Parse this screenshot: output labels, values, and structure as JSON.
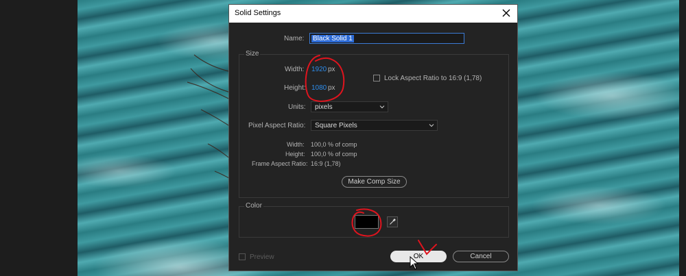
{
  "dialog": {
    "title": "Solid Settings",
    "name_label": "Name:",
    "name_value": "Black Solid 1",
    "size": {
      "group_title": "Size",
      "width_label": "Width:",
      "width_value": "1920",
      "width_unit": "px",
      "height_label": "Height:",
      "height_value": "1080",
      "height_unit": "px",
      "lock_label": "Lock Aspect Ratio to 16:9 (1,78)",
      "lock_checked": false,
      "units_label": "Units:",
      "units_value": "pixels",
      "par_label": "Pixel Aspect Ratio:",
      "par_value": "Square Pixels",
      "info_width_label": "Width:",
      "info_width_value": "100,0 % of comp",
      "info_height_label": "Height:",
      "info_height_value": "100,0 % of comp",
      "far_label": "Frame Aspect Ratio:",
      "far_value": "16:9 (1,78)",
      "make_comp_size": "Make Comp Size"
    },
    "color": {
      "group_title": "Color",
      "swatch": "#000000"
    },
    "preview_label": "Preview",
    "preview_checked": false,
    "ok_label": "OK",
    "cancel_label": "Cancel"
  },
  "icons": {
    "close": "close-icon",
    "eyedropper": "eyedropper-icon",
    "chevron": "chevron-down-icon",
    "cursor": "mouse-cursor-icon"
  },
  "colors": {
    "accent_value": "#2d8ceb",
    "annotation": "#e0141e",
    "dialog_bg": "#232323"
  }
}
